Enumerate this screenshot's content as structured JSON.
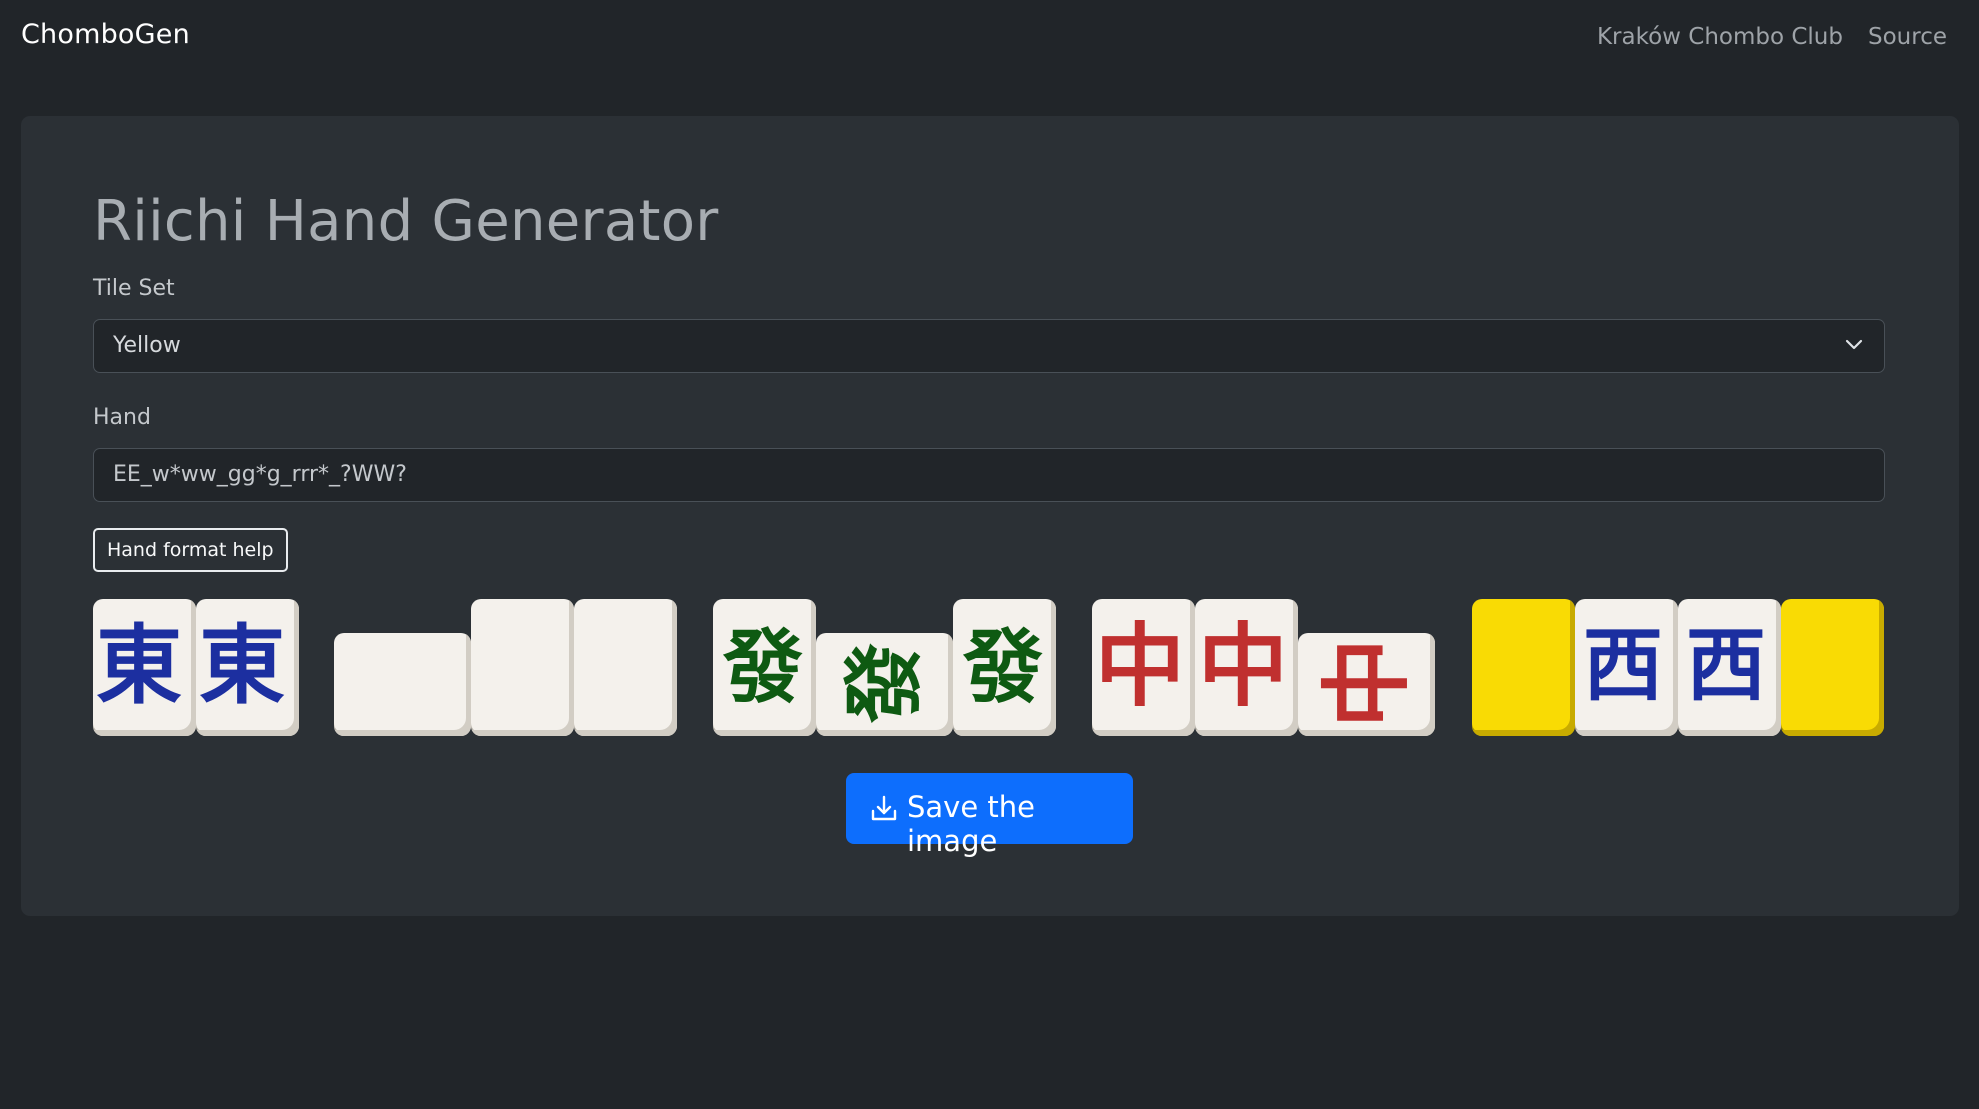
{
  "navbar": {
    "brand": "ChomboGen",
    "links": [
      "Kraków Chombo Club",
      "Source"
    ]
  },
  "main": {
    "title": "Riichi Hand Generator",
    "tile_set": {
      "label": "Tile Set",
      "value": "Yellow"
    },
    "hand": {
      "label": "Hand",
      "value": "EE_w*ww_gg*g_rrr*_?WW?"
    },
    "help_button": "Hand format help",
    "save_button": "Save the image"
  },
  "tiles": {
    "east": "東",
    "green": "發",
    "red": "中",
    "west": "西"
  },
  "colors": {
    "background": "#212529",
    "card": "#2b3035",
    "primary": "#0d6efd",
    "tile_face": "#f4f1ec",
    "tile_back": "#f9db04",
    "east_ink": "#1c2fa0",
    "green_ink": "#0e5a12",
    "red_ink": "#c0302f",
    "west_ink": "#1c2fa0"
  },
  "icons": [
    "chevron-down-icon",
    "download-icon"
  ]
}
